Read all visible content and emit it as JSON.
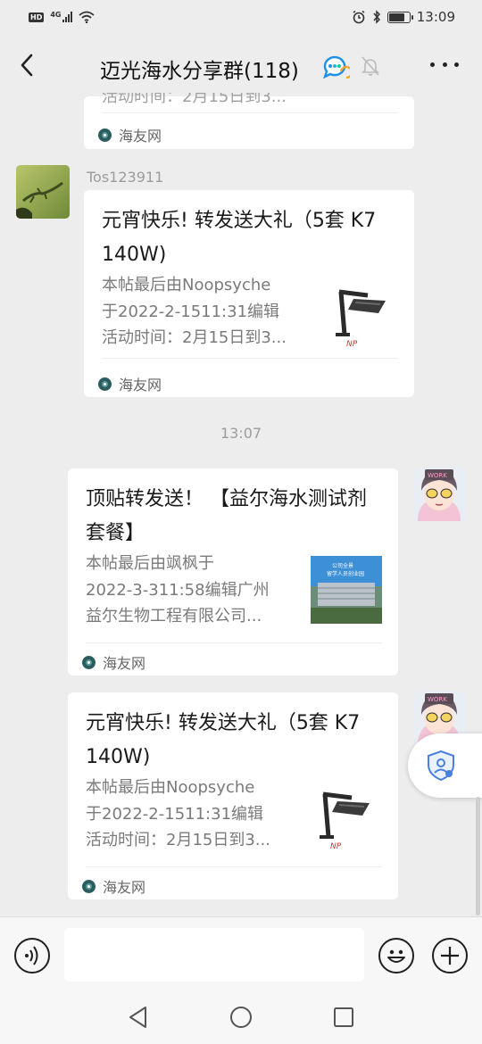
{
  "status_bar": {
    "hd": "HD",
    "network": "4G",
    "time": "13:09",
    "battery_level": 0.8
  },
  "header": {
    "title": "迈光海水分享群(118)"
  },
  "messages": {
    "top_card": {
      "partial_desc": "活动时间：2月15日到3...",
      "source": "海友网"
    },
    "msg1": {
      "sender": "Tos123911",
      "title": "元宵快乐! 转发送大礼（5套 K7  140W)",
      "desc_lines": [
        "本帖最后由Noopsyche",
        "于2022-2-1511:31编辑",
        "活动时间：2月15日到3..."
      ],
      "source": "海友网"
    },
    "time_separator": "13:07",
    "msg2": {
      "title": "顶贴转发送！  【益尔海水测试剂套餐】",
      "desc_lines": [
        "本帖最后由飒枫于",
        "2022-3-311:58编辑广州",
        "益尔生物工程有限公司..."
      ],
      "thumb_text": [
        "公司全景",
        "留学人员创业园"
      ],
      "source": "海友网"
    },
    "msg3": {
      "title": "元宵快乐! 转发送大礼（5套 K7  140W)",
      "desc_lines": [
        "本帖最后由Noopsyche",
        "于2022-2-1511:31编辑",
        "活动时间：2月15日到3..."
      ],
      "source": "海友网"
    }
  },
  "input_bar": {
    "text_value": ""
  },
  "colors": {
    "background": "#ededed",
    "card": "#ffffff",
    "secondary_text": "#9c9c9c",
    "link_accent": "#2b5d5f"
  }
}
